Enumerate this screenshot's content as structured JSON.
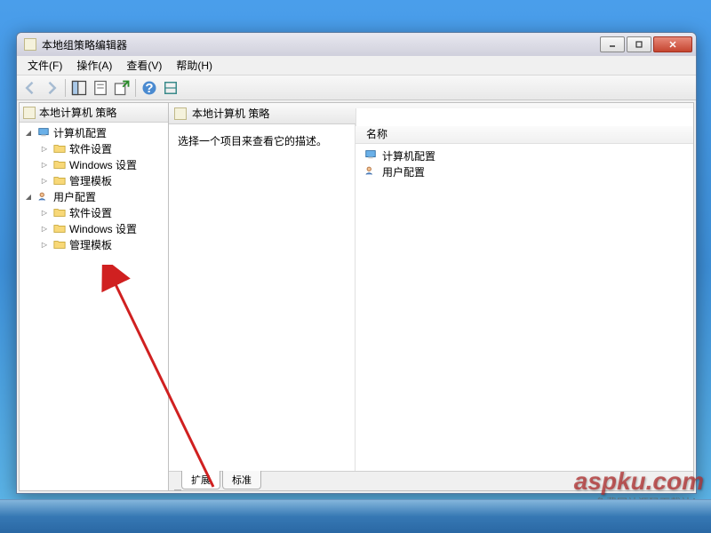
{
  "window": {
    "title": "本地组策略编辑器"
  },
  "menubar": {
    "file": "文件(F)",
    "action": "操作(A)",
    "view": "查看(V)",
    "help": "帮助(H)"
  },
  "tree": {
    "root": "本地计算机 策略",
    "computer_config": "计算机配置",
    "computer_children": [
      "软件设置",
      "Windows 设置",
      "管理模板"
    ],
    "user_config": "用户配置",
    "user_children": [
      "软件设置",
      "Windows 设置",
      "管理模板"
    ]
  },
  "main": {
    "header": "本地计算机 策略",
    "description": "选择一个项目来查看它的描述。",
    "column_name": "名称",
    "items": [
      {
        "label": "计算机配置",
        "icon": "computer"
      },
      {
        "label": "用户配置",
        "icon": "user"
      }
    ]
  },
  "tabs": {
    "extended": "扩展",
    "standard": "标准"
  },
  "watermark": {
    "main": "aspku.com",
    "sub": "免费网站源码下载站！"
  }
}
